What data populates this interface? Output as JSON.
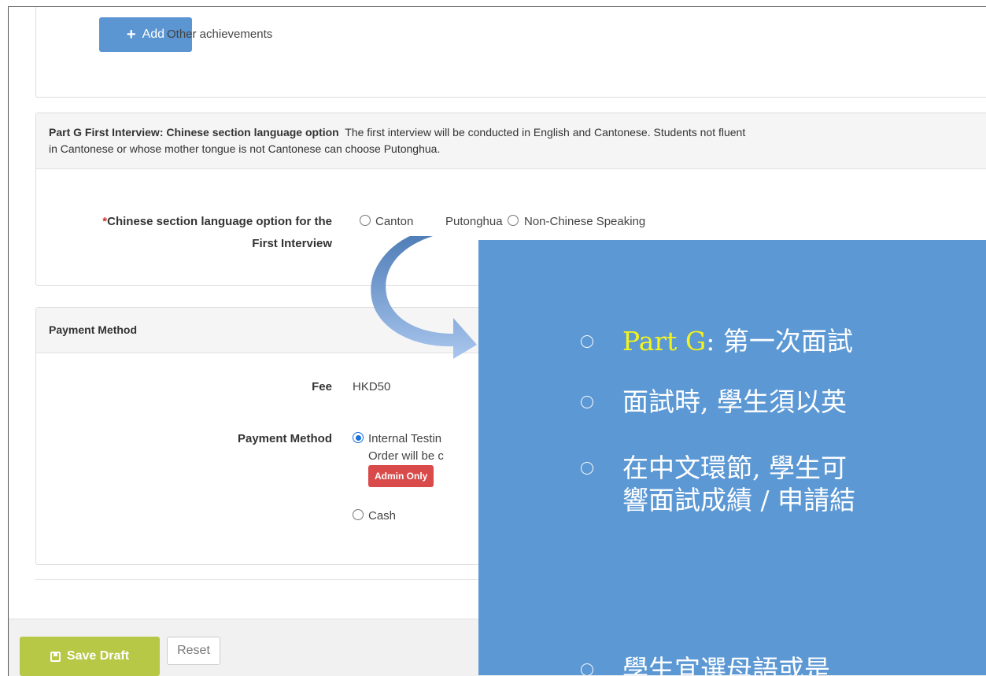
{
  "achievements": {
    "add_label": "Add",
    "add_caption": "Other achievements"
  },
  "part_g": {
    "title": "Part G First Interview: Chinese section language option",
    "description_line1": "The first interview will be conducted in English and Cantonese. Students not fluent",
    "description_line2": "in Cantonese or whose mother tongue is not Cantonese can choose Putonghua.",
    "field_required_mark": "*",
    "field_label_line1": "Chinese section language option for the",
    "field_label_line2": "First Interview",
    "options": [
      "Canton",
      "Putonghua",
      "Non-Chinese Speaking"
    ]
  },
  "payment": {
    "title": "Payment Method",
    "fee_label": "Fee",
    "fee_value": "HKD50",
    "method_label": "Payment Method",
    "option1_line1": "Internal Testin",
    "option1_line2": "Order will be c",
    "option1_badge": "Admin Only",
    "option2": "Cash"
  },
  "footer": {
    "save_label": "Save Draft",
    "reset_label": "Reset"
  },
  "overlay": {
    "b1_prefix": "Part G",
    "b1_rest": ": 第一次面試",
    "b2": "面試時, 學生須以英",
    "b3_line1": "在中文環節, 學生可",
    "b3_line2": "響面試成績 / 申請結",
    "b4": "學生宜選母語或是"
  },
  "colors": {
    "primary_button": "#5b95d2",
    "save_button": "#b6c846",
    "badge": "#d94a4a",
    "overlay_bg": "#5c98d4",
    "highlight_text": "#f3f31e",
    "radio_checked": "#1a6fd8"
  }
}
